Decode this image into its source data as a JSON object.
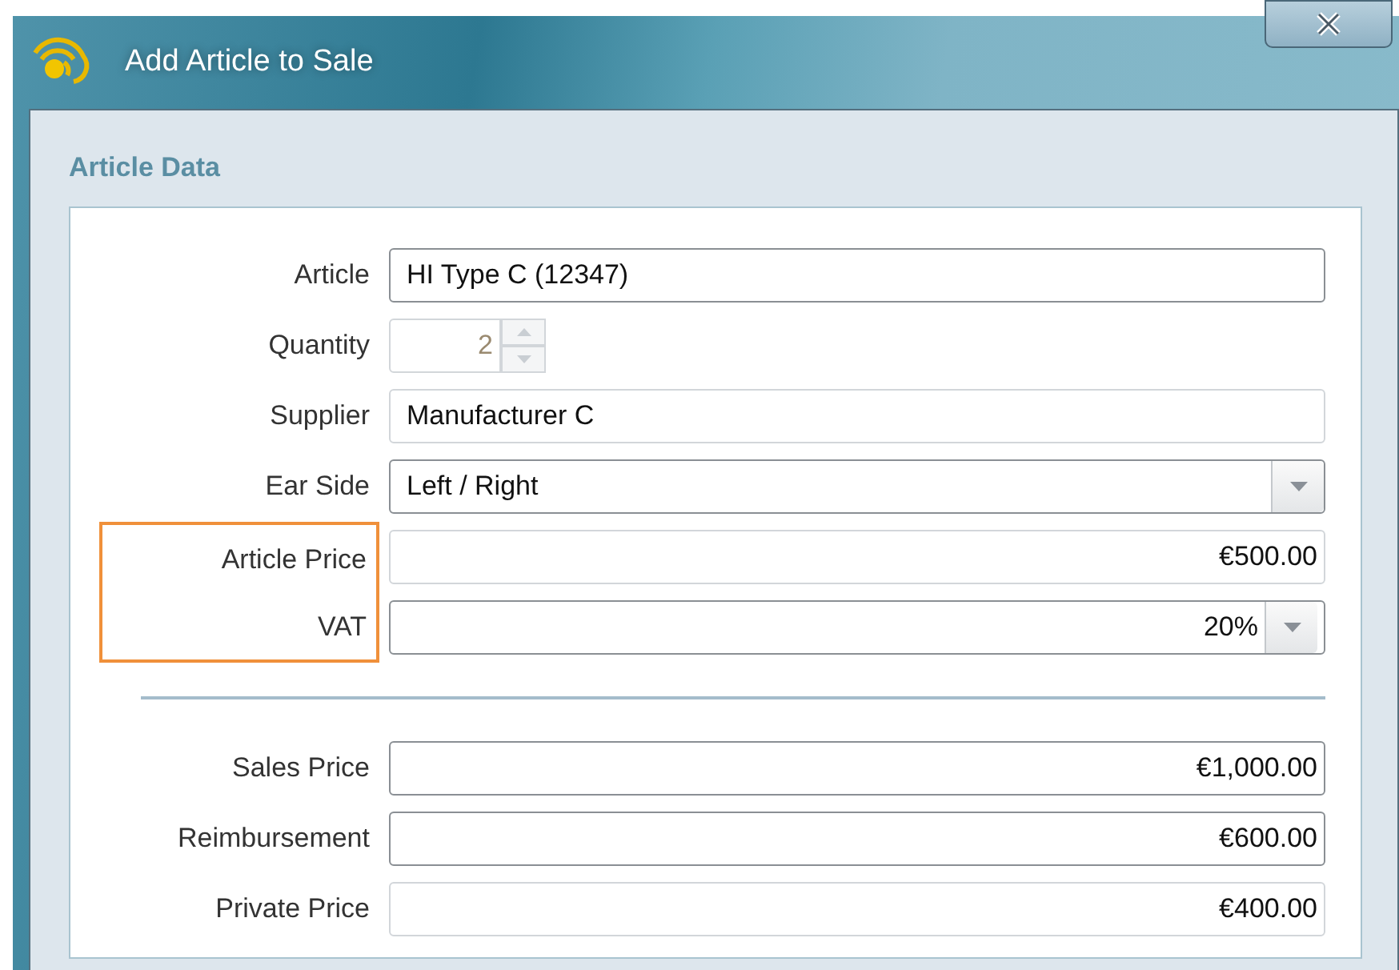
{
  "window": {
    "title": "Add Article to Sale"
  },
  "section": {
    "title": "Article Data"
  },
  "groups": [
    {
      "rows": [
        {
          "label": "Article",
          "kind": "text",
          "value": "HI Type C (12347)",
          "readonly": false,
          "numeric": false,
          "disabled": false,
          "highlighted": false
        },
        {
          "label": "Quantity",
          "kind": "spinner",
          "value": "2",
          "readonly": false,
          "numeric": true,
          "disabled": true,
          "highlighted": false
        },
        {
          "label": "Supplier",
          "kind": "text",
          "value": "Manufacturer C",
          "readonly": true,
          "numeric": false,
          "disabled": false,
          "highlighted": false
        },
        {
          "label": "Ear Side",
          "kind": "combo",
          "value": "Left / Right",
          "readonly": false,
          "numeric": false,
          "disabled": false,
          "highlighted": false
        },
        {
          "label": "Article Price",
          "kind": "text",
          "value": "€500.00",
          "readonly": true,
          "numeric": true,
          "disabled": false,
          "highlighted": true
        },
        {
          "label": "VAT",
          "kind": "combo",
          "value": "20%",
          "readonly": false,
          "numeric": true,
          "disabled": false,
          "highlighted": true
        }
      ]
    },
    {
      "rows": [
        {
          "label": "Sales Price",
          "kind": "text",
          "value": "€1,000.00",
          "readonly": false,
          "numeric": true,
          "disabled": false,
          "highlighted": false
        },
        {
          "label": "Reimbursement",
          "kind": "text",
          "value": "€600.00",
          "readonly": false,
          "numeric": true,
          "disabled": false,
          "highlighted": false
        },
        {
          "label": "Private Price",
          "kind": "text",
          "value": "€400.00",
          "readonly": true,
          "numeric": true,
          "disabled": false,
          "highlighted": false
        }
      ]
    }
  ]
}
